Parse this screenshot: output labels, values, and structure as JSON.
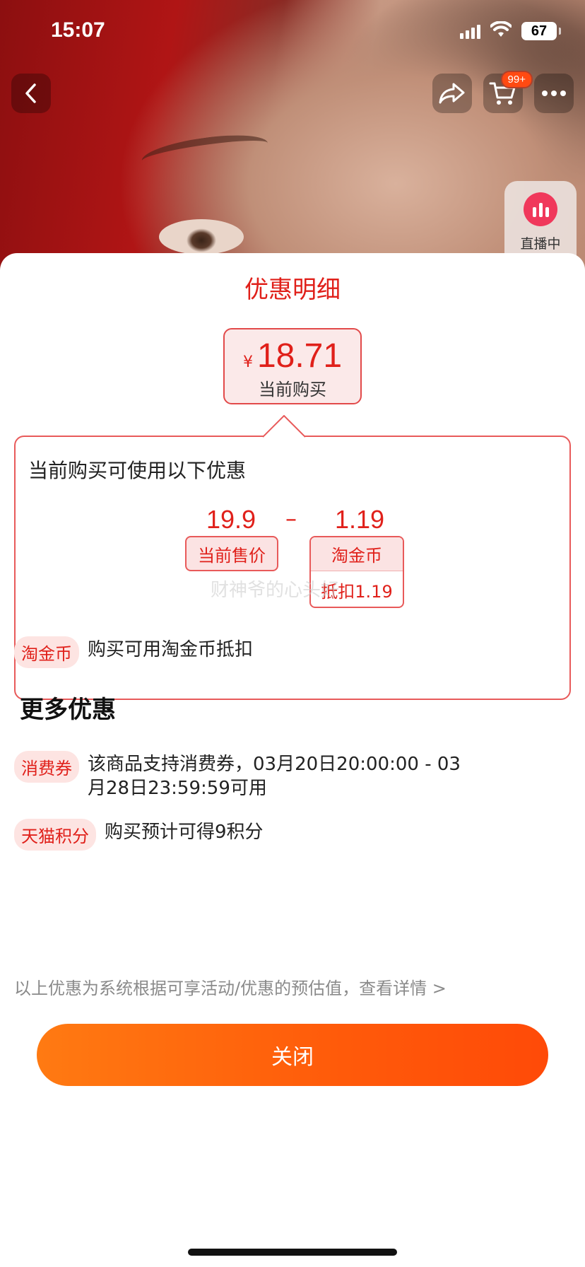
{
  "status_bar": {
    "time": "15:07",
    "battery": "67"
  },
  "nav": {
    "cart_badge": "99+",
    "live_label": "直播中"
  },
  "sheet": {
    "title": "优惠明细",
    "price": {
      "currency": "¥",
      "value": "18.71",
      "label": "当前购买"
    },
    "detail": {
      "heading": "当前购买可使用以下优惠",
      "original_price": "19.9",
      "operator": "–",
      "discount": "1.19",
      "price_tag": "当前售价",
      "coin_tag": "淘金币",
      "coin_deduct": "抵扣1.19",
      "watermark": "财神爷的心头好"
    },
    "coin_row": {
      "badge": "淘金币",
      "text": "购买可用淘金币抵扣"
    },
    "more": {
      "title": "更多优惠",
      "items": [
        {
          "badge": "消费券",
          "text": "该商品支持消费券，03月20日20:00:00 - 03月28日23:59:59可用"
        },
        {
          "badge": "天猫积分",
          "text": "购买预计可得9积分"
        }
      ]
    },
    "disclaimer": "以上优惠为系统根据可享活动/优惠的预估值，查看详情 >",
    "close_label": "关闭"
  },
  "colors": {
    "accent": "#e0201a",
    "button": "#ff5a0a"
  }
}
